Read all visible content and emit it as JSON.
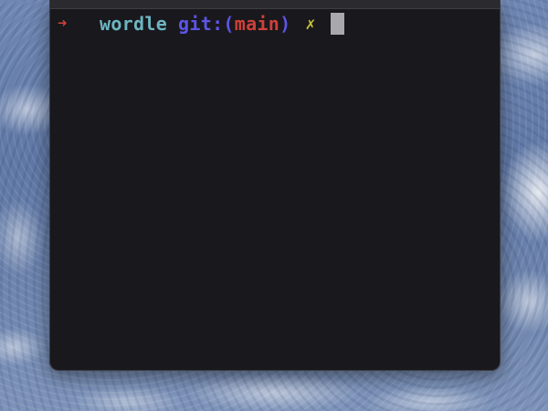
{
  "prompt": {
    "arrow": "➜",
    "directory": "wordle",
    "git_label": "git:(",
    "branch": "main",
    "git_close": ")",
    "dirty_marker": "✗"
  },
  "colors": {
    "terminal_bg": "#19181c",
    "arrow": "#d0403a",
    "directory": "#6cb6c2",
    "git": "#5c55e6",
    "branch": "#d0403a",
    "dirty_marker": "#c8c23a",
    "cursor": "#a9a8ad"
  }
}
